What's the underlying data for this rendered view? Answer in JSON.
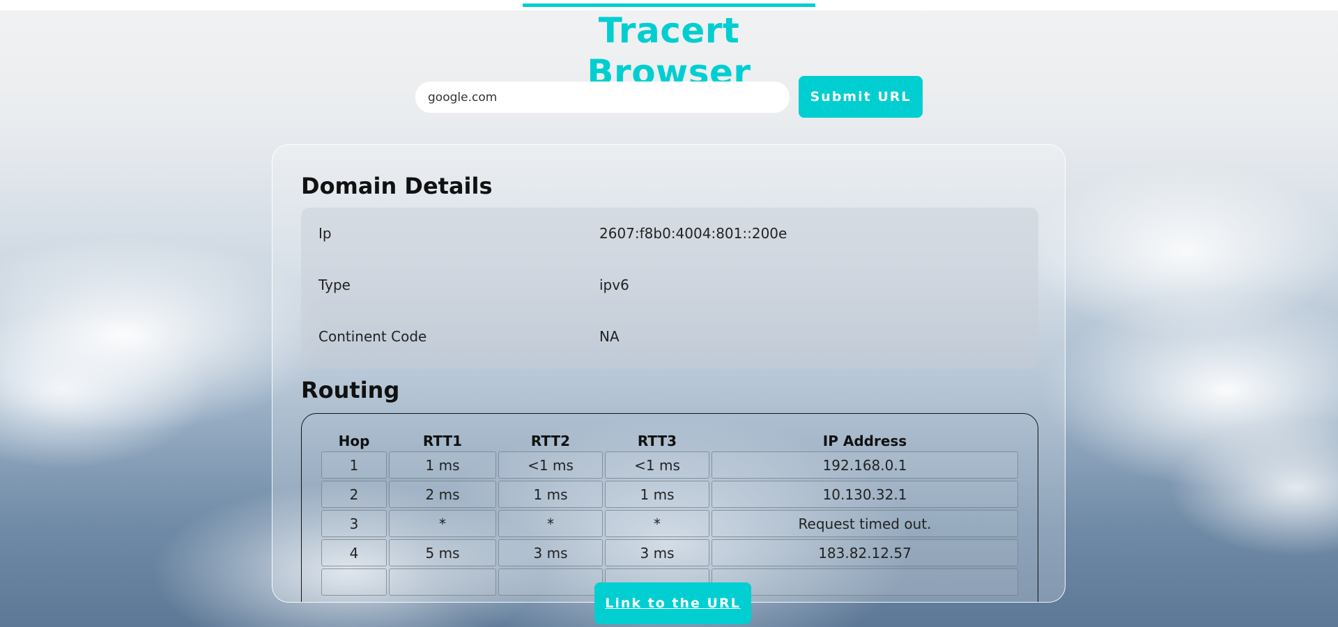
{
  "app": {
    "title": "Tracert Browser",
    "accent_color": "#00ced1"
  },
  "search": {
    "value": "google.com",
    "submit_label": "Submit URL"
  },
  "domain_details": {
    "heading": "Domain Details",
    "rows": [
      {
        "label": "Ip",
        "value": "2607:f8b0:4004:801::200e"
      },
      {
        "label": "Type",
        "value": "ipv6"
      },
      {
        "label": "Continent Code",
        "value": "NA"
      }
    ]
  },
  "routing": {
    "heading": "Routing",
    "columns": [
      "Hop",
      "RTT1",
      "RTT2",
      "RTT3",
      "IP Address"
    ],
    "rows": [
      [
        "1",
        "1 ms",
        "<1 ms",
        "<1 ms",
        "192.168.0.1"
      ],
      [
        "2",
        "2 ms",
        "1 ms",
        "1 ms",
        "10.130.32.1"
      ],
      [
        "3",
        "*",
        "*",
        "*",
        "Request timed out."
      ],
      [
        "4",
        "5 ms",
        "3 ms",
        "3 ms",
        "183.82.12.57"
      ],
      [
        "",
        "",
        "",
        "",
        ""
      ]
    ]
  },
  "footer": {
    "link_label": "Link to the URL"
  }
}
